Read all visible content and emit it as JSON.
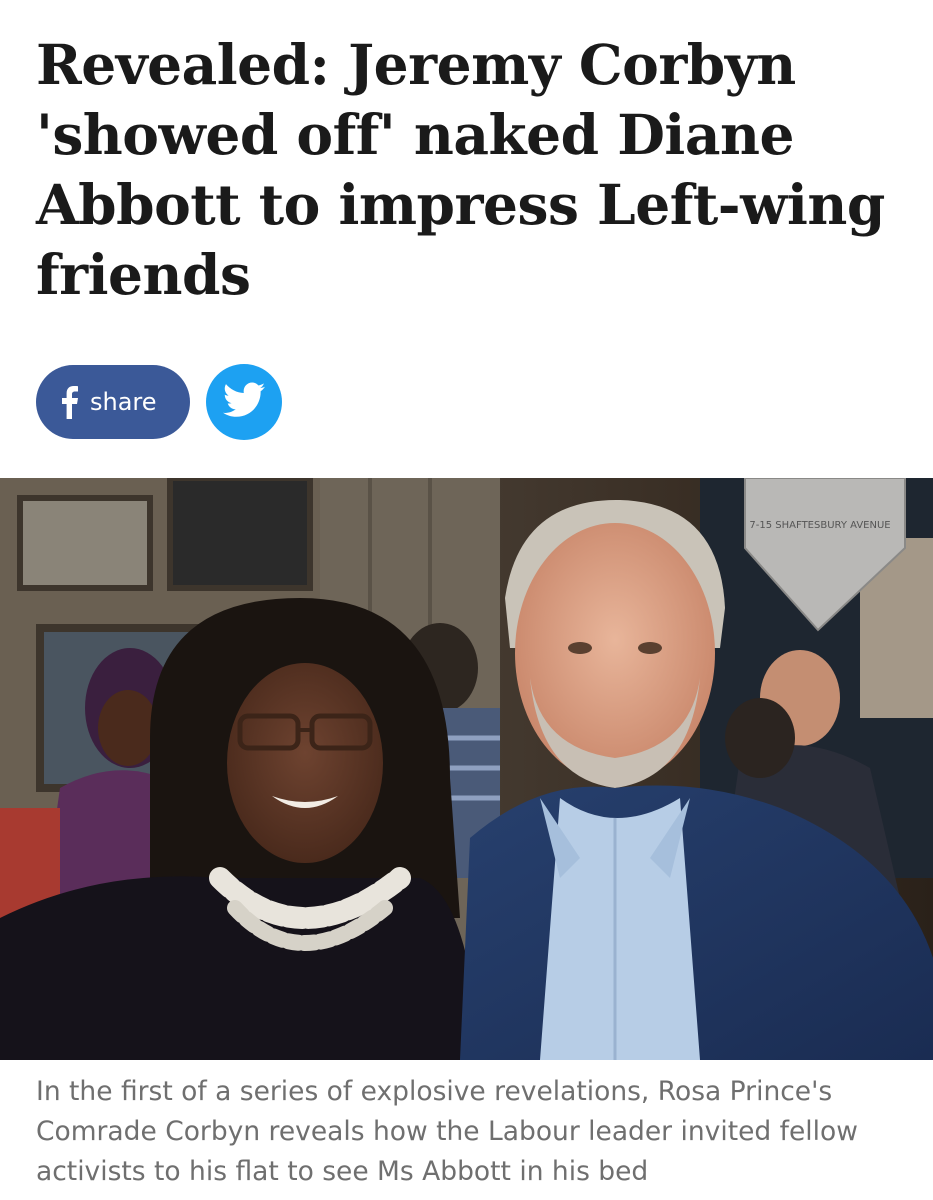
{
  "article": {
    "headline": "Revealed: Jeremy Corbyn 'showed off' naked Diane Abbott to impress Left-wing friends",
    "caption": "In the first of a series of explosive revelations, Rosa Prince's Comrade Corbyn reveals how the Labour leader invited fellow activists to his flat to see Ms Abbott in his bed"
  },
  "share": {
    "facebook_label": "share",
    "facebook_icon": "facebook-f-icon",
    "twitter_icon": "twitter-bird-icon"
  },
  "photo": {
    "banner_text": "7-15 SHAFTESBURY AVENUE",
    "description_icon": "photo-image"
  },
  "colors": {
    "headline": "#1a1a1a",
    "facebook": "#3b5998",
    "twitter": "#1da1f2",
    "caption": "#6f6f6f"
  }
}
